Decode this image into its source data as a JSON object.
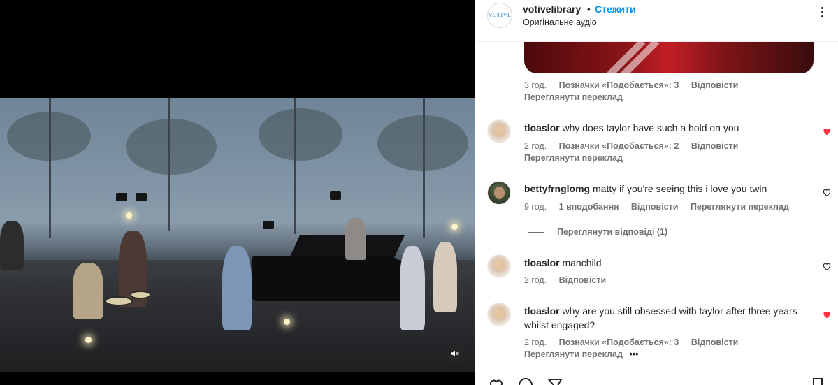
{
  "video": {
    "mute_icon": "muted-speaker-icon"
  },
  "post": {
    "account_logo_text": "VOTIVE",
    "username": "votivelibrary",
    "separator": "•",
    "follow_label": "Стежити",
    "audio_label": "Оригінальне аудіо",
    "more_icon": "more-options-icon"
  },
  "comments": [
    {
      "username": "",
      "text": "",
      "time": "3 год.",
      "likes": "Позначки «Подобається»: 3",
      "reply": "Відповісти",
      "translation": "Переглянути переклад",
      "liked": null
    },
    {
      "username": "tloaslor",
      "text": "why does taylor have such a hold on you",
      "time": "2 год.",
      "likes": "Позначки «Подобається»: 2",
      "reply": "Відповісти",
      "translation": "Переглянути переклад",
      "liked": true
    },
    {
      "username": "bettyfrnglomg",
      "text": "matty if you're seeing this i love you twin",
      "time": "9 год.",
      "likes": "1 вподобання",
      "reply": "Відповісти",
      "translation": "Переглянути переклад",
      "liked": false,
      "view_replies": "Переглянути відповіді (1)"
    },
    {
      "username": "tloaslor",
      "text": "manchild",
      "time": "2 год.",
      "reply": "Відповісти",
      "liked": false
    },
    {
      "username": "tloaslor",
      "text": "why are you still obsessed with taylor after three years whilst engaged?",
      "time": "2 год.",
      "likes": "Позначки «Подобається»: 3",
      "reply": "Відповісти",
      "translation": "Переглянути переклад",
      "more": "•••",
      "liked": true
    }
  ],
  "colors": {
    "accent": "#0095f6",
    "liked_heart": "#ff3040",
    "muted_text": "#737373"
  }
}
